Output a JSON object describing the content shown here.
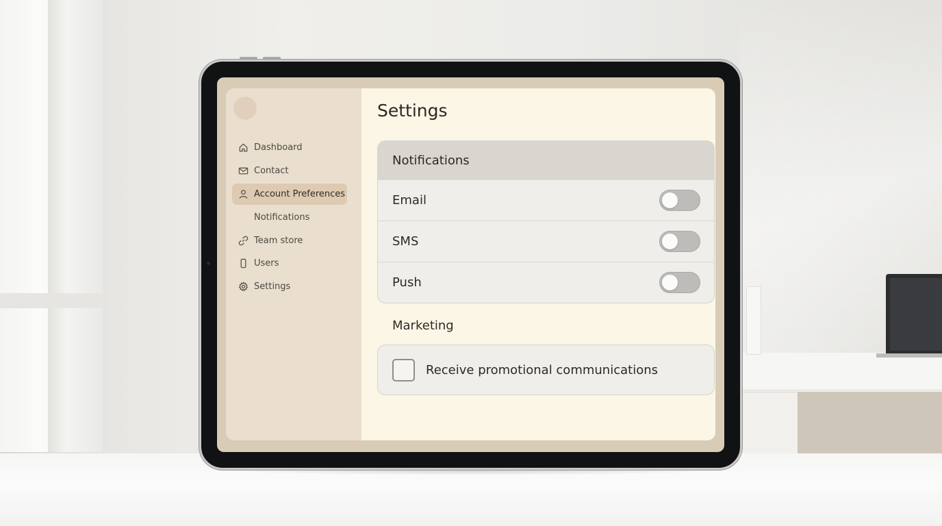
{
  "sidebar": {
    "items": [
      {
        "label": "Dashboard",
        "icon": "home-icon"
      },
      {
        "label": "Contact",
        "icon": "mail-icon"
      },
      {
        "label": "Account Preferences",
        "icon": "user-icon",
        "active": true
      },
      {
        "label": "Notifications",
        "icon": null
      },
      {
        "label": "Team store",
        "icon": "link-icon"
      },
      {
        "label": "Users",
        "icon": "phone-icon"
      },
      {
        "label": "Settings",
        "icon": "gear-icon"
      }
    ]
  },
  "main": {
    "title": "Settings",
    "notifications": {
      "header": "Notifications",
      "rows": [
        {
          "label": "Email",
          "enabled": false
        },
        {
          "label": "SMS",
          "enabled": false
        },
        {
          "label": "Push",
          "enabled": false
        }
      ]
    },
    "marketing": {
      "title": "Marketing",
      "checkbox_label": "Receive promotional communications",
      "checked": false
    }
  },
  "colors": {
    "sidebar_bg": "#eadfce",
    "active_item": "#decab1",
    "main_bg": "#fbf6e5",
    "card_header": "#d8d6ce"
  }
}
